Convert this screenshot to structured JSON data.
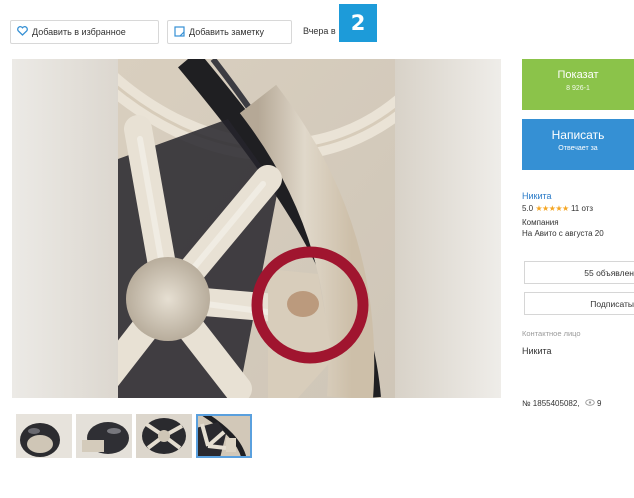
{
  "toolbar": {
    "favorite_label": "Добавить в избранное",
    "note_label": "Добавить заметку",
    "posted": "Вчера в"
  },
  "badge": "2",
  "sidebar": {
    "show_phone": {
      "label": "Показат",
      "sub": "8 926-1"
    },
    "message": {
      "label": "Написать",
      "sub": "Отвечает за"
    },
    "seller": {
      "name": "Никита",
      "rating": "5.0",
      "stars": "★★★★★",
      "reviews": "11 отз",
      "type": "Компания",
      "since": "На Авито с августа 20"
    },
    "listings_button": "55 объявлен",
    "subscribe_button": "Подписаты",
    "contact_label": "Контактное лицо",
    "contact_name": "Никита",
    "listing_number": "№ 1855405082,",
    "views": "9"
  },
  "icons": {
    "favorite": "heart-icon",
    "note": "note-icon",
    "views": "eye-icon"
  },
  "colors": {
    "accent_green": "#8bc34a",
    "accent_blue": "#3590d4",
    "badge": "#1d9bd9",
    "highlight_circle": "#a0152f",
    "link": "#2a7bc8"
  },
  "thumbnails": [
    "helmet-front",
    "helmet-side",
    "helmet-inside",
    "helmet-liner-closeup"
  ],
  "active_thumbnail": 3
}
